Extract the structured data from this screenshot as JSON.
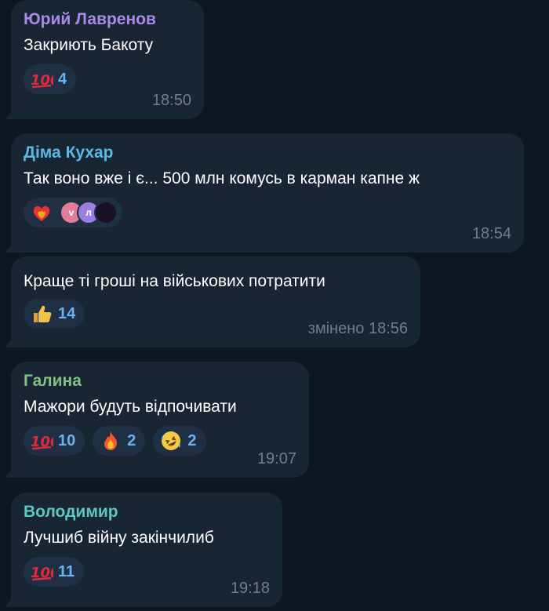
{
  "colors": {
    "background": "#0e1621",
    "bubble": "#182533",
    "reaction_bg": "#1f3045",
    "reaction_count": "#6ab2f2",
    "time": "#6d7f8f"
  },
  "messages": [
    {
      "author": "Юрий Лавренов",
      "author_color": "#a88be8",
      "text": "Закриють Бакоту",
      "reactions": [
        {
          "emoji": "hundred-points-icon",
          "count": "4"
        }
      ],
      "time": "18:50"
    },
    {
      "author": "Діма Кухар",
      "author_color": "#5cb8e9",
      "text": "Так воно вже і є... 500 млн комусь в карман капне ж",
      "reaction_emoji": "fire-heart-icon",
      "avatar_letters": [
        "v",
        "л"
      ],
      "time": "18:54"
    },
    {
      "text": "Краще ті гроші на військових потратити",
      "reactions": [
        {
          "emoji": "thumbs-up-icon",
          "count": "14"
        }
      ],
      "time": "змінено 18:56"
    },
    {
      "author": "Галина",
      "author_color": "#7ec384",
      "text": "Мажори будуть відпочивати",
      "reactions": [
        {
          "emoji": "hundred-points-icon",
          "count": "10"
        },
        {
          "emoji": "fire-icon",
          "count": "2"
        },
        {
          "emoji": "rofl-face-icon",
          "count": "2"
        }
      ],
      "time": "19:07"
    },
    {
      "author": "Володимир",
      "author_color": "#5dc8c2",
      "text": "Лучшиб війну закінчилиб",
      "reactions": [
        {
          "emoji": "hundred-points-icon",
          "count": "11"
        }
      ],
      "time": "19:18"
    }
  ]
}
